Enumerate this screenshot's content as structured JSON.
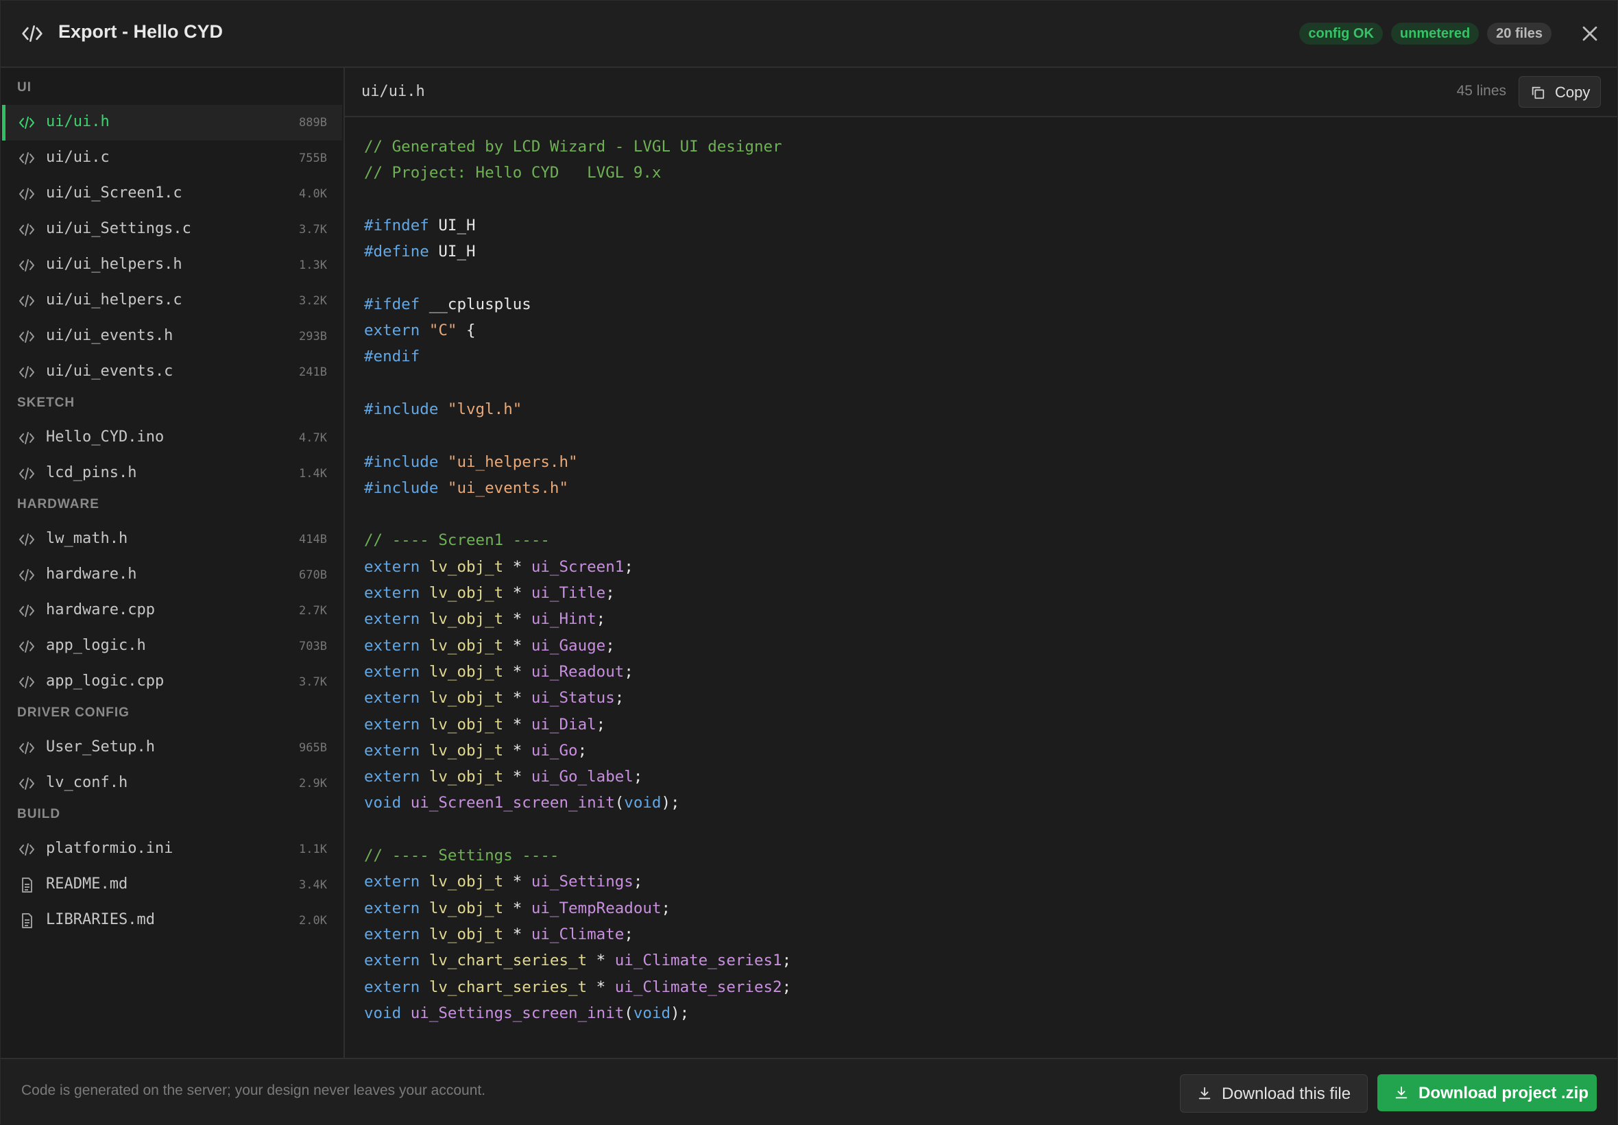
{
  "header": {
    "title": "Export - Hello CYD",
    "badges": [
      "config OK",
      "unmetered",
      "20 files"
    ]
  },
  "sidebar": {
    "sections": [
      {
        "label": "UI",
        "items": [
          {
            "name": "ui/ui.h",
            "size": "889B"
          },
          {
            "name": "ui/ui.c",
            "size": "755B"
          },
          {
            "name": "ui/ui_Screen1.c",
            "size": "4.0K"
          },
          {
            "name": "ui/ui_Settings.c",
            "size": "3.7K"
          },
          {
            "name": "ui/ui_helpers.h",
            "size": "1.3K"
          },
          {
            "name": "ui/ui_helpers.c",
            "size": "3.2K"
          },
          {
            "name": "ui/ui_events.h",
            "size": "293B"
          },
          {
            "name": "ui/ui_events.c",
            "size": "241B"
          }
        ]
      },
      {
        "label": "SKETCH",
        "items": [
          {
            "name": "Hello_CYD.ino",
            "size": "4.7K"
          },
          {
            "name": "lcd_pins.h",
            "size": "1.4K"
          }
        ]
      },
      {
        "label": "HARDWARE",
        "items": [
          {
            "name": "lw_math.h",
            "size": "414B"
          },
          {
            "name": "hardware.h",
            "size": "670B"
          },
          {
            "name": "hardware.cpp",
            "size": "2.7K"
          },
          {
            "name": "app_logic.h",
            "size": "703B"
          },
          {
            "name": "app_logic.cpp",
            "size": "3.7K"
          }
        ]
      },
      {
        "label": "DRIVER CONFIG",
        "items": [
          {
            "name": "User_Setup.h",
            "size": "965B"
          },
          {
            "name": "lv_conf.h",
            "size": "2.9K"
          }
        ]
      },
      {
        "label": "BUILD",
        "items": [
          {
            "name": "platformio.ini",
            "size": "1.1K"
          },
          {
            "name": "README.md",
            "size": "3.4K"
          },
          {
            "name": "LIBRARIES.md",
            "size": "2.0K"
          }
        ]
      }
    ]
  },
  "viewer": {
    "path": "ui/ui.h",
    "lines": "45 lines",
    "copy_label": "Copy"
  },
  "code_lines": [
    [
      [
        "c-com",
        "// Generated by LCD Wizard - LVGL UI designer"
      ]
    ],
    [
      [
        "c-com",
        "// Project: Hello CYD   LVGL 9.x"
      ]
    ],
    [],
    [
      [
        "c-kw",
        "#ifndef"
      ],
      [
        "",
        " UI_H"
      ]
    ],
    [
      [
        "c-kw",
        "#define"
      ],
      [
        "",
        " UI_H"
      ]
    ],
    [],
    [
      [
        "c-kw",
        "#ifdef"
      ],
      [
        "",
        " __cplusplus"
      ]
    ],
    [
      [
        "c-kw",
        "extern"
      ],
      [
        "",
        " "
      ],
      [
        "c-str",
        "\"C\""
      ],
      [
        "",
        " {"
      ]
    ],
    [
      [
        "c-kw",
        "#endif"
      ]
    ],
    [],
    [
      [
        "c-kw",
        "#include"
      ],
      [
        "",
        " "
      ],
      [
        "c-str",
        "\"lvgl.h\""
      ]
    ],
    [],
    [
      [
        "c-kw",
        "#include"
      ],
      [
        "",
        " "
      ],
      [
        "c-str",
        "\"ui_helpers.h\""
      ]
    ],
    [
      [
        "c-kw",
        "#include"
      ],
      [
        "",
        " "
      ],
      [
        "c-str",
        "\"ui_events.h\""
      ]
    ],
    [],
    [
      [
        "c-com",
        "// ---- Screen1 ----"
      ]
    ],
    [
      [
        "c-kw",
        "extern"
      ],
      [
        "",
        " "
      ],
      [
        "c-typ",
        "lv_obj_t"
      ],
      [
        "",
        " * "
      ],
      [
        "c-id",
        "ui_Screen1"
      ],
      [
        "",
        ";"
      ]
    ],
    [
      [
        "c-kw",
        "extern"
      ],
      [
        "",
        " "
      ],
      [
        "c-typ",
        "lv_obj_t"
      ],
      [
        "",
        " * "
      ],
      [
        "c-id",
        "ui_Title"
      ],
      [
        "",
        ";"
      ]
    ],
    [
      [
        "c-kw",
        "extern"
      ],
      [
        "",
        " "
      ],
      [
        "c-typ",
        "lv_obj_t"
      ],
      [
        "",
        " * "
      ],
      [
        "c-id",
        "ui_Hint"
      ],
      [
        "",
        ";"
      ]
    ],
    [
      [
        "c-kw",
        "extern"
      ],
      [
        "",
        " "
      ],
      [
        "c-typ",
        "lv_obj_t"
      ],
      [
        "",
        " * "
      ],
      [
        "c-id",
        "ui_Gauge"
      ],
      [
        "",
        ";"
      ]
    ],
    [
      [
        "c-kw",
        "extern"
      ],
      [
        "",
        " "
      ],
      [
        "c-typ",
        "lv_obj_t"
      ],
      [
        "",
        " * "
      ],
      [
        "c-id",
        "ui_Readout"
      ],
      [
        "",
        ";"
      ]
    ],
    [
      [
        "c-kw",
        "extern"
      ],
      [
        "",
        " "
      ],
      [
        "c-typ",
        "lv_obj_t"
      ],
      [
        "",
        " * "
      ],
      [
        "c-id",
        "ui_Status"
      ],
      [
        "",
        ";"
      ]
    ],
    [
      [
        "c-kw",
        "extern"
      ],
      [
        "",
        " "
      ],
      [
        "c-typ",
        "lv_obj_t"
      ],
      [
        "",
        " * "
      ],
      [
        "c-id",
        "ui_Dial"
      ],
      [
        "",
        ";"
      ]
    ],
    [
      [
        "c-kw",
        "extern"
      ],
      [
        "",
        " "
      ],
      [
        "c-typ",
        "lv_obj_t"
      ],
      [
        "",
        " * "
      ],
      [
        "c-id",
        "ui_Go"
      ],
      [
        "",
        ";"
      ]
    ],
    [
      [
        "c-kw",
        "extern"
      ],
      [
        "",
        " "
      ],
      [
        "c-typ",
        "lv_obj_t"
      ],
      [
        "",
        " * "
      ],
      [
        "c-id",
        "ui_Go_label"
      ],
      [
        "",
        ";"
      ]
    ],
    [
      [
        "c-kw",
        "void"
      ],
      [
        "",
        " "
      ],
      [
        "c-id",
        "ui_Screen1_screen_init"
      ],
      [
        "",
        "("
      ],
      [
        "c-kw",
        "void"
      ],
      [
        "",
        ");"
      ]
    ],
    [],
    [
      [
        "c-com",
        "// ---- Settings ----"
      ]
    ],
    [
      [
        "c-kw",
        "extern"
      ],
      [
        "",
        " "
      ],
      [
        "c-typ",
        "lv_obj_t"
      ],
      [
        "",
        " * "
      ],
      [
        "c-id",
        "ui_Settings"
      ],
      [
        "",
        ";"
      ]
    ],
    [
      [
        "c-kw",
        "extern"
      ],
      [
        "",
        " "
      ],
      [
        "c-typ",
        "lv_obj_t"
      ],
      [
        "",
        " * "
      ],
      [
        "c-id",
        "ui_TempReadout"
      ],
      [
        "",
        ";"
      ]
    ],
    [
      [
        "c-kw",
        "extern"
      ],
      [
        "",
        " "
      ],
      [
        "c-typ",
        "lv_obj_t"
      ],
      [
        "",
        " * "
      ],
      [
        "c-id",
        "ui_Climate"
      ],
      [
        "",
        ";"
      ]
    ],
    [
      [
        "c-kw",
        "extern"
      ],
      [
        "",
        " "
      ],
      [
        "c-typ",
        "lv_chart_series_t"
      ],
      [
        "",
        " * "
      ],
      [
        "c-id",
        "ui_Climate_series1"
      ],
      [
        "",
        ";"
      ]
    ],
    [
      [
        "c-kw",
        "extern"
      ],
      [
        "",
        " "
      ],
      [
        "c-typ",
        "lv_chart_series_t"
      ],
      [
        "",
        " * "
      ],
      [
        "c-id",
        "ui_Climate_series2"
      ],
      [
        "",
        ";"
      ]
    ],
    [
      [
        "c-kw",
        "void"
      ],
      [
        "",
        " "
      ],
      [
        "c-id",
        "ui_Settings_screen_init"
      ],
      [
        "",
        "("
      ],
      [
        "c-kw",
        "void"
      ],
      [
        "",
        ");"
      ]
    ]
  ],
  "footer": {
    "note": "Code is generated on the server; your design never leaves your account.",
    "download_file_label": "Download this file",
    "download_zip_label": "Download project .zip"
  },
  "colors": {
    "accent": "#22a34d",
    "active_text": "#3bd46f"
  }
}
